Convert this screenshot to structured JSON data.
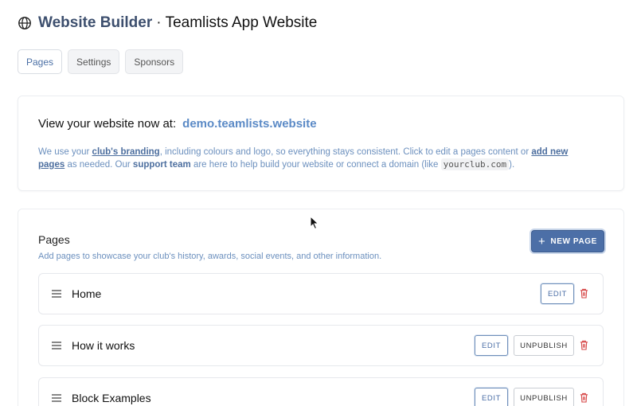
{
  "header": {
    "app_name": "Website Builder",
    "separator": "·",
    "site_name": "Teamlists App Website"
  },
  "tabs": [
    {
      "label": "Pages",
      "active": true
    },
    {
      "label": "Settings",
      "active": false
    },
    {
      "label": "Sponsors",
      "active": false
    }
  ],
  "info": {
    "view_label": "View your website now at:",
    "url": "demo.teamlists.website",
    "p1": "We use your ",
    "branding_link": "club's branding",
    "p2": ", including colours and logo, so everything stays consistent. Click to edit a pages content or ",
    "add_pages_link": "add new pages",
    "p3": " as needed. Our ",
    "support": "support team",
    "p4": " are here to help build your website or connect a domain (like ",
    "domain_example": "yourclub.com",
    "p5": ")."
  },
  "pages_section": {
    "title": "Pages",
    "description": "Add pages to showcase your club's history, awards, social events, and other information.",
    "new_page_label": "NEW PAGE",
    "edit_label": "EDIT",
    "unpublish_label": "UNPUBLISH",
    "rows": [
      {
        "name": "Home"
      },
      {
        "name": "How it works"
      },
      {
        "name": "Block Examples"
      }
    ]
  },
  "colors": {
    "accent": "#4c6fa7",
    "link": "#5b8ac6",
    "danger": "#d64545"
  }
}
